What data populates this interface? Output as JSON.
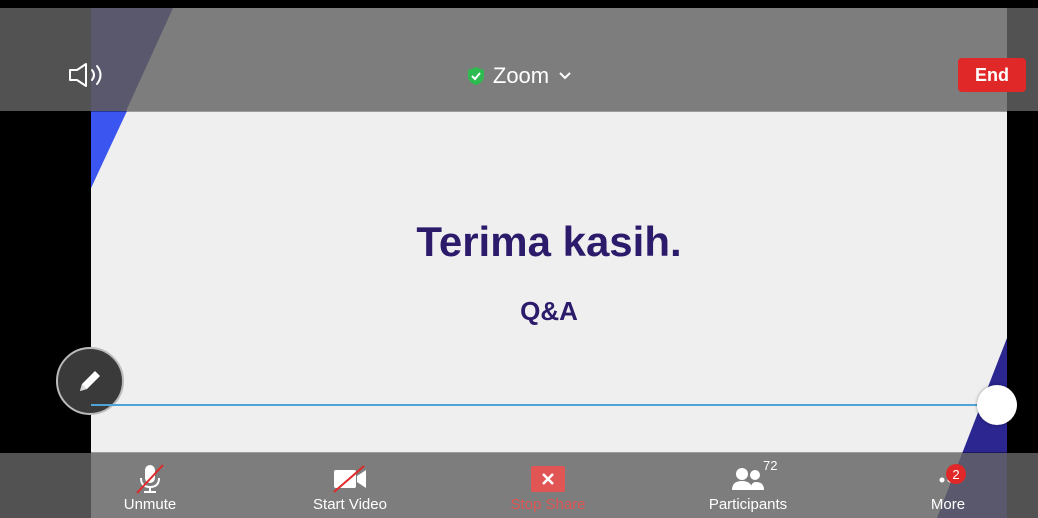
{
  "colors": {
    "slide_text": "#2c1a6b",
    "end_button": "#e02828",
    "shield": "#2dbb4f",
    "accent_blue": "#3a55f0",
    "deco_dark": "#2b2690",
    "annotation_line": "#4fa3d9"
  },
  "header": {
    "speaker_icon": "speaker-icon",
    "title": "Zoom",
    "end_label": "End"
  },
  "slide": {
    "title": "Terima kasih.",
    "subtitle": "Q&A"
  },
  "annotate": {
    "icon": "pencil-icon"
  },
  "toolbar": {
    "unmute": "Unmute",
    "start_video": "Start Video",
    "stop_share": "Stop Share",
    "participants": "Participants",
    "participants_count": "72",
    "more": "More",
    "more_badge": "2"
  }
}
